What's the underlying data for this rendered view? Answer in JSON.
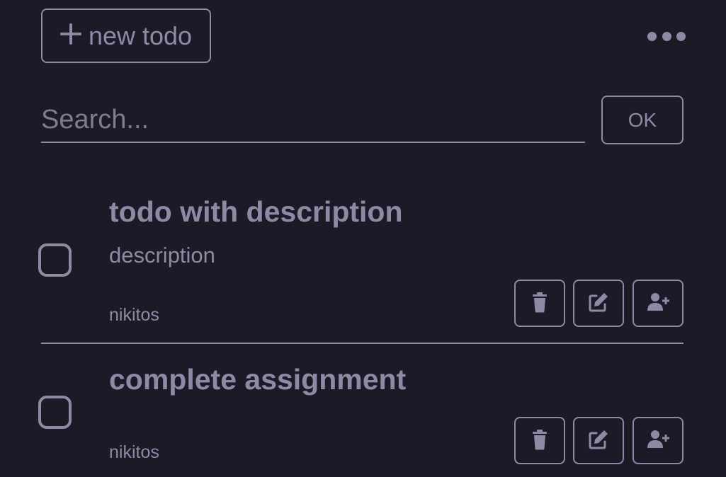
{
  "header": {
    "new_todo_label": "new todo",
    "new_todo_icon": "plus-icon",
    "more_icon": "more-horizontal-icon"
  },
  "search": {
    "placeholder": "Search...",
    "value": "",
    "ok_label": "OK"
  },
  "todos": [
    {
      "title": "todo with description",
      "description": "description",
      "user": "nikitos",
      "completed": false
    },
    {
      "title": "complete assignment",
      "description": "",
      "user": "nikitos",
      "completed": false
    }
  ],
  "actions": {
    "delete_icon": "trash-icon",
    "edit_icon": "edit-icon",
    "assign_icon": "user-plus-icon"
  },
  "colors": {
    "background": "#1c1a26",
    "foreground": "#8d8aa6"
  }
}
